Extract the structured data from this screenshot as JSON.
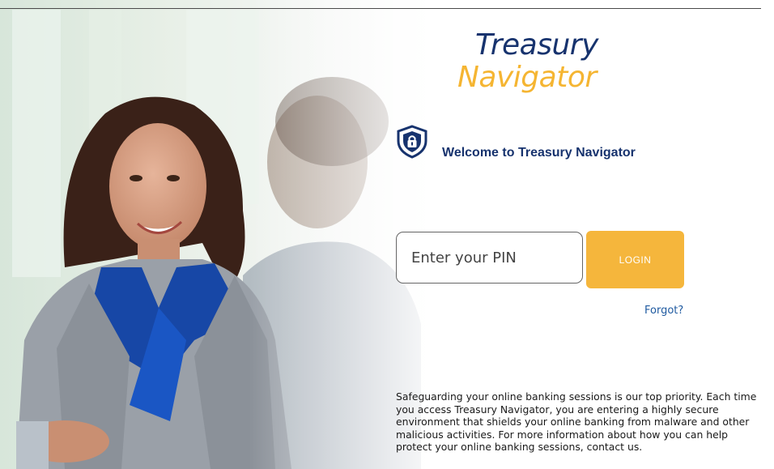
{
  "hero": {
    "image": "businesswoman-meeting-photo"
  },
  "logo": {
    "line1": "Treasury",
    "line2": "Navigator"
  },
  "welcome": {
    "icon": "shield-lock-icon",
    "text": "Welcome to Treasury Navigator"
  },
  "login": {
    "pin_placeholder": "Enter your PIN",
    "pin_value": "",
    "button_label": "LOGIN",
    "forgot_label": "Forgot?"
  },
  "notice": {
    "text": "Safeguarding your online banking sessions is our top priority. Each time you access Treasury Navigator, you are entering a highly secure environment that shields your online banking from malware and other malicious activities. For more information about how you can help protect your online banking sessions, contact us."
  },
  "colors": {
    "brand_navy": "#17336e",
    "accent_gold": "#f5b532",
    "link_blue": "#1f5aa0"
  }
}
